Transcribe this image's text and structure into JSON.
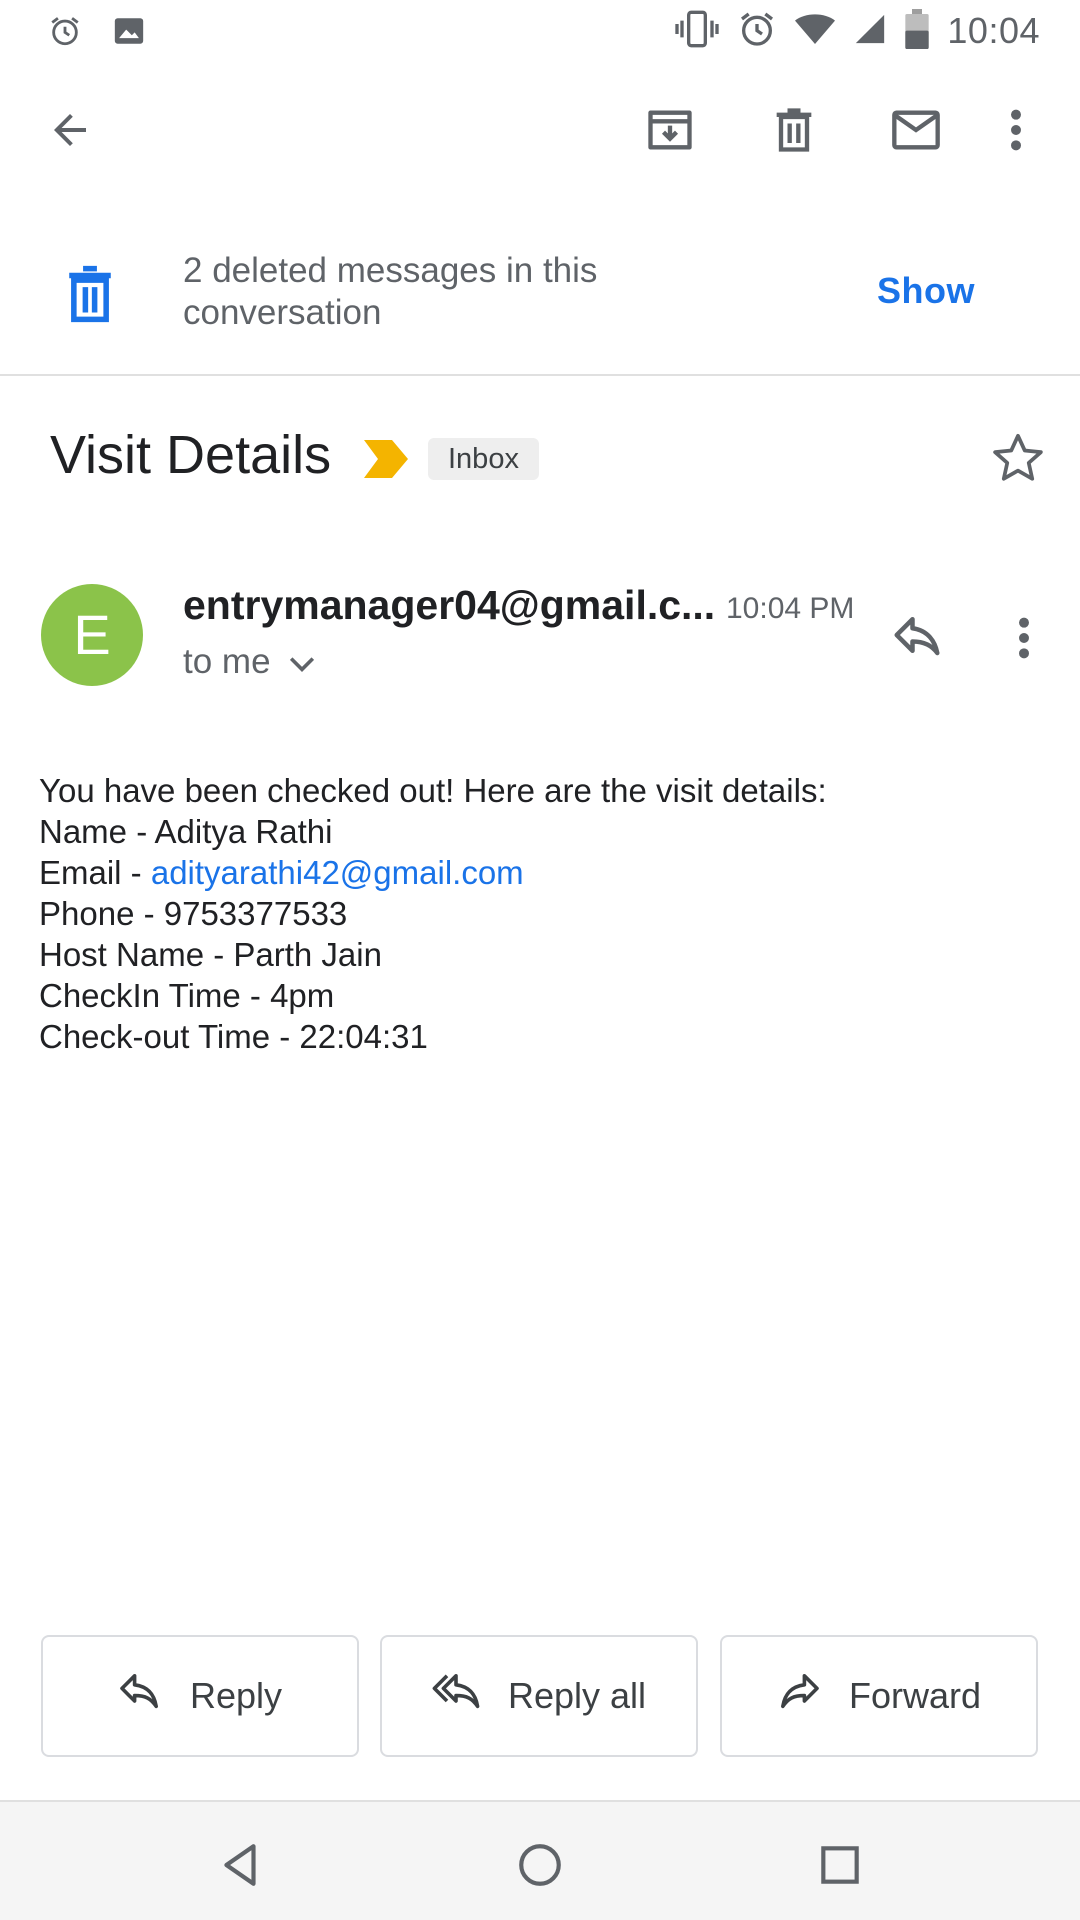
{
  "status_bar": {
    "time": "10:04",
    "left_icons": [
      "alarm-icon",
      "image-icon"
    ],
    "right_icons": [
      "vibrate-icon",
      "alarm-icon",
      "wifi-icon",
      "signal-icon",
      "battery-icon"
    ]
  },
  "toolbar": {
    "back_icon": "back-arrow-icon",
    "actions": [
      "archive-icon",
      "delete-icon",
      "mark-unread-icon",
      "more-vert-icon"
    ]
  },
  "deleted_banner": {
    "text": "2 deleted messages in this conversation",
    "action_label": "Show"
  },
  "subject": {
    "title": "Visit Details",
    "label": "Inbox",
    "importance_color": "#f4b400"
  },
  "sender": {
    "avatar_letter": "E",
    "avatar_color": "#8bc34a",
    "name": "entrymanager04@gmail.c...",
    "time": "10:04 PM",
    "recipient": "to me"
  },
  "message": {
    "intro": "You have been checked out! Here are the visit details:",
    "name_line": "Name - Aditya Rathi",
    "email_prefix": "Email - ",
    "email": "adityarathi42@gmail.com",
    "phone_line": "Phone - 9753377533",
    "host_line": "Host Name - Parth Jain",
    "checkin_line": "CheckIn Time - 4pm",
    "checkout_line": "Check-out Time - 22:04:31"
  },
  "actions": {
    "reply": "Reply",
    "reply_all": "Reply all",
    "forward": "Forward"
  },
  "nav_bar": {
    "buttons": [
      "back-triangle-icon",
      "home-circle-icon",
      "recents-square-icon"
    ]
  },
  "colors": {
    "accent": "#1a73e8",
    "text_secondary": "#5f6368"
  }
}
